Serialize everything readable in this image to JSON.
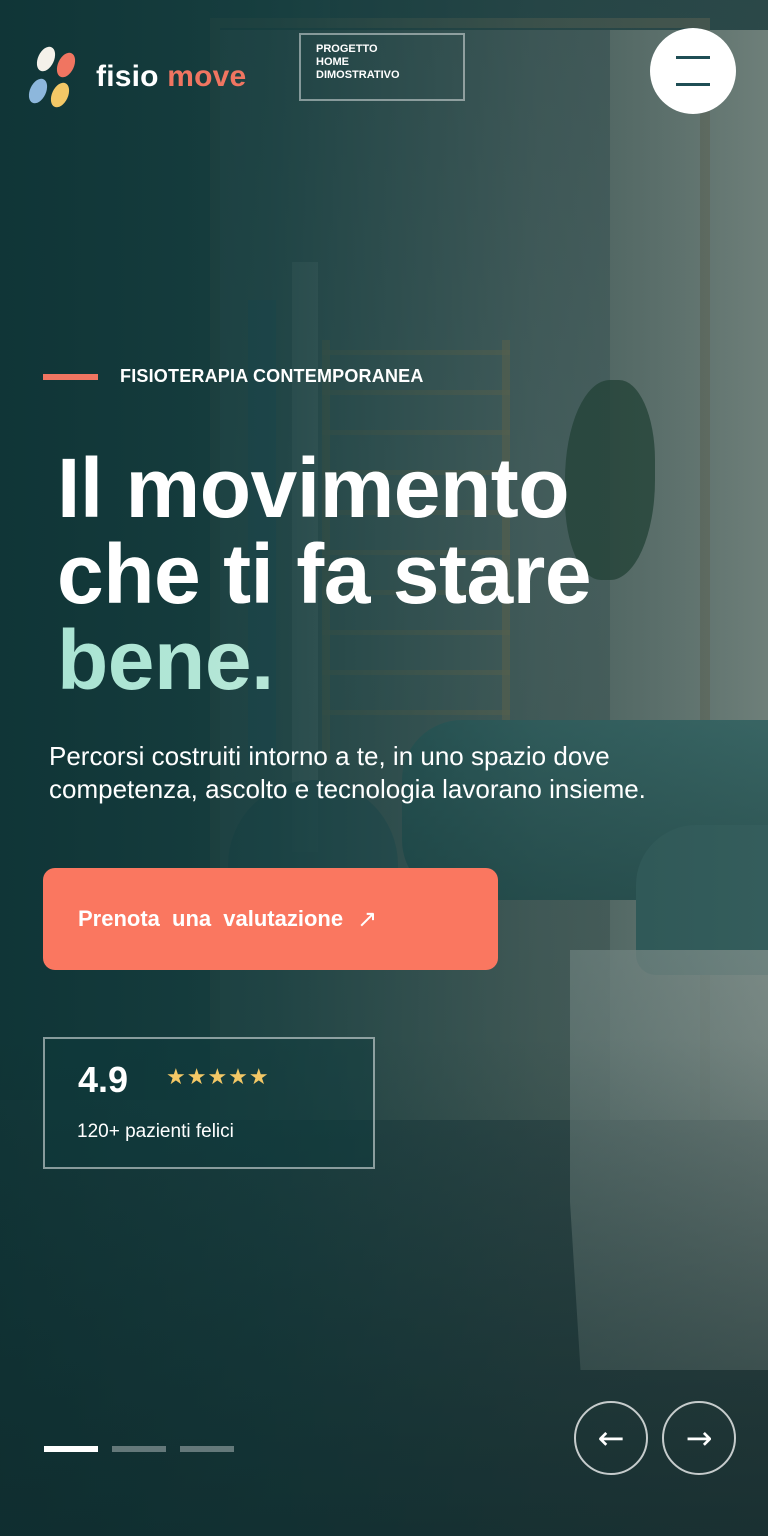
{
  "header": {
    "logo": {
      "word1": "fisio",
      "word2": "move"
    },
    "badge": [
      "PROGETTO",
      "HOME",
      "DIMOSTRATIVO"
    ],
    "menu_icon": "hamburger-menu-icon"
  },
  "hero": {
    "eyebrow": "FISIOTERAPIA CONTEMPORANEA",
    "headline": {
      "line1": "Il movimento",
      "line2": "che ti fa stare",
      "highlight": "bene."
    },
    "subtitle": "Percorsi costruiti intorno a te, in uno spazio dove competenza, ascolto e tecnologia lavorano insieme.",
    "cta": {
      "label": "Prenota una valutazione",
      "icon": "↗"
    }
  },
  "rating": {
    "score": "4.9",
    "stars": "★★★★★",
    "caption": "120+ pazienti felici"
  },
  "slider": {
    "active_index": 0,
    "slide_count": 3,
    "prev_icon": "←",
    "next_icon": "→"
  },
  "colors": {
    "accent": "#fa7760",
    "brand_dark": "#1f4e55",
    "highlight": "#a9e4d3",
    "star": "#f3c866"
  }
}
